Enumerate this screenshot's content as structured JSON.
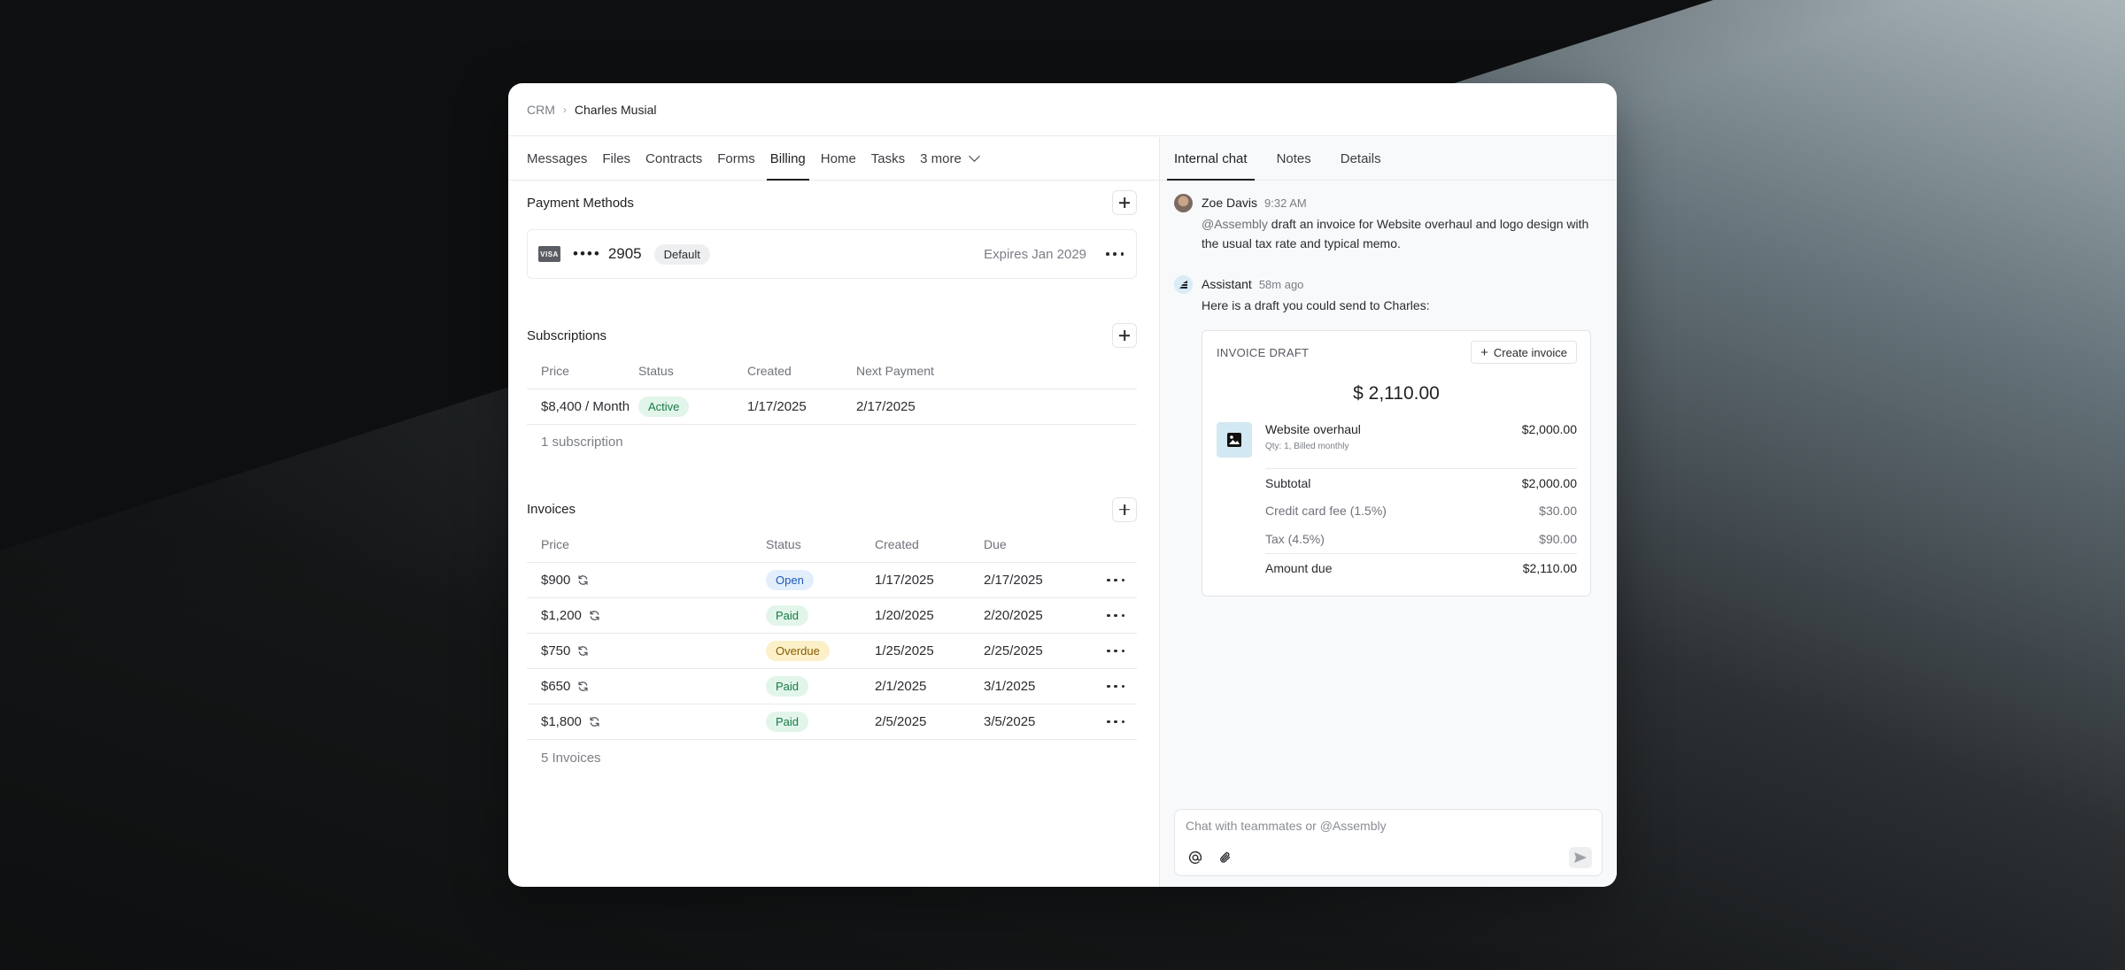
{
  "breadcrumb": {
    "root": "CRM",
    "separator": "›",
    "current": "Charles Musial"
  },
  "tabs": [
    {
      "label": "Messages"
    },
    {
      "label": "Files"
    },
    {
      "label": "Contracts"
    },
    {
      "label": "Forms"
    },
    {
      "label": "Billing",
      "active": true
    },
    {
      "label": "Home"
    },
    {
      "label": "Tasks"
    },
    {
      "label": "3 more"
    }
  ],
  "payment_methods": {
    "title": "Payment Methods",
    "card": {
      "brand": "VISA",
      "mask": "••••",
      "last4": "2905",
      "badge": "Default",
      "expires": "Expires Jan 2029"
    }
  },
  "subscriptions": {
    "title": "Subscriptions",
    "columns": [
      "Price",
      "Status",
      "Created",
      "Next Payment"
    ],
    "rows": [
      {
        "price": "$8,400 / Month",
        "status": "Active",
        "created": "1/17/2025",
        "next": "2/17/2025"
      }
    ],
    "footer": "1 subscription"
  },
  "invoices": {
    "title": "Invoices",
    "columns": [
      "Price",
      "Status",
      "Created",
      "Due"
    ],
    "rows": [
      {
        "price": "$900",
        "status": "Open",
        "created": "1/17/2025",
        "due": "2/17/2025"
      },
      {
        "price": "$1,200",
        "status": "Paid",
        "created": "1/20/2025",
        "due": "2/20/2025"
      },
      {
        "price": "$750",
        "status": "Overdue",
        "created": "1/25/2025",
        "due": "2/25/2025"
      },
      {
        "price": "$650",
        "status": "Paid",
        "created": "2/1/2025",
        "due": "3/1/2025"
      },
      {
        "price": "$1,800",
        "status": "Paid",
        "created": "2/5/2025",
        "due": "3/5/2025"
      }
    ],
    "footer": "5 Invoices"
  },
  "right_tabs": [
    {
      "label": "Internal chat",
      "active": true
    },
    {
      "label": "Notes"
    },
    {
      "label": "Details"
    }
  ],
  "chat": {
    "message1": {
      "name": "Zoe Davis",
      "time": "9:32 AM",
      "mention": "@Assembly",
      "text": " draft an invoice for Website overhaul and logo design with the usual tax rate and typical memo."
    },
    "message2": {
      "name": "Assistant",
      "time": "58m ago",
      "text": "Here is a draft you could send to Charles:"
    },
    "invoice_draft": {
      "label": "INVOICE DRAFT",
      "create_label": "Create invoice",
      "total": "$ 2,110.00",
      "item": {
        "title": "Website overhaul",
        "sub": "Qty: 1, Billed monthly",
        "price": "$2,000.00"
      },
      "subtotal": {
        "label": "Subtotal",
        "value": "$2,000.00"
      },
      "fee": {
        "label": "Credit card fee (1.5%)",
        "value": "$30.00"
      },
      "tax": {
        "label": "Tax (4.5%)",
        "value": "$90.00"
      },
      "amount_due": {
        "label": "Amount due",
        "value": "$2,110.00"
      }
    },
    "composer_placeholder": "Chat with teammates or @Assembly"
  }
}
